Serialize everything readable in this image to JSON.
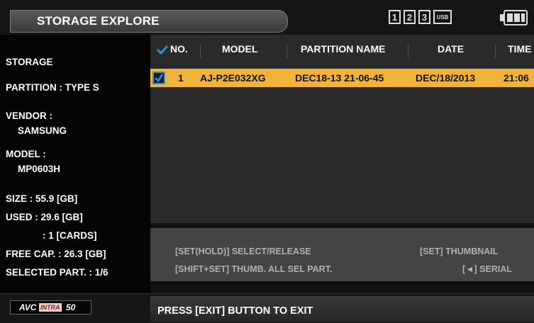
{
  "header": {
    "title": "STORAGE EXPLORE",
    "media_slots": [
      "1",
      "2",
      "3",
      "USB"
    ]
  },
  "storage_info": {
    "heading": "STORAGE",
    "partition": "PARTITION : TYPE S",
    "vendor_label": "VENDOR :",
    "vendor_value": "SAMSUNG",
    "model_label": "MODEL :",
    "model_value": "MP0603H",
    "size": "SIZE : 55.9 [GB]",
    "used": "USED : 29.6 [GB]",
    "used_cards": ": 1 [CARDS]",
    "free_cap": "FREE CAP. : 26.3 [GB]",
    "selected_part": "SELECTED PART. : 1/6"
  },
  "table": {
    "columns": [
      "NO.",
      "MODEL",
      "PARTITION NAME",
      "DATE",
      "TIME"
    ],
    "rows": [
      {
        "no": "1",
        "model": "AJ-P2E032XG",
        "partition_name": "DEC18-13 21-06-45",
        "date": "DEC/18/2013",
        "time": "21:06",
        "selected": true
      }
    ]
  },
  "help": {
    "select_release": "[SET(HOLD)] SELECT/RELEASE",
    "thumbnail": "[SET] THUMBNAIL",
    "thumb_all": "[SHIFT+SET] THUMB. ALL SEL PART.",
    "serial": "[◄] SERIAL"
  },
  "footer": {
    "badge_avc": "AVC",
    "badge_intra": "INTRA",
    "badge_num": "50",
    "exit_text": "PRESS [EXIT] BUTTON TO EXIT"
  },
  "colors": {
    "selected_row": "#f0b43a",
    "checkbox": "#2e8fe0"
  }
}
